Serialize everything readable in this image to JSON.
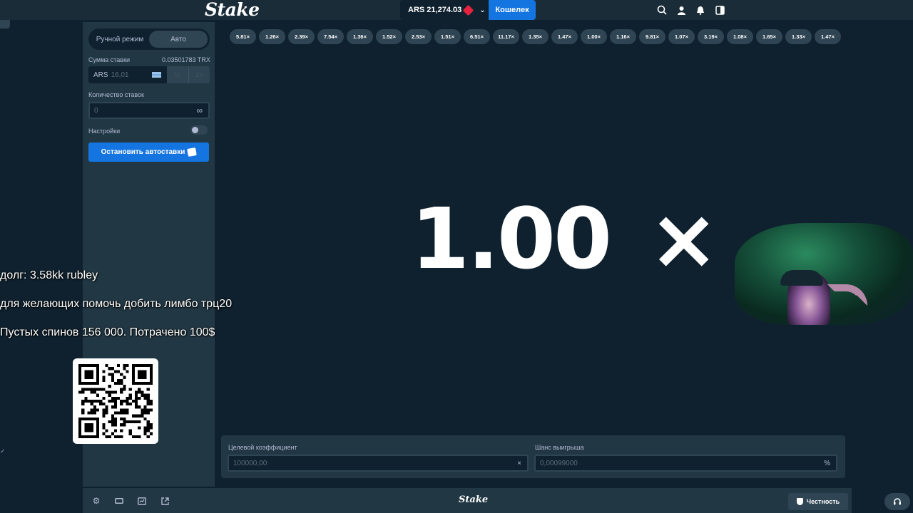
{
  "app": {
    "logo": "Stake",
    "footer_logo": "Stake"
  },
  "topbar": {
    "currency": "ARS",
    "balance": "21,274.03",
    "wallet_label": "Кошелек"
  },
  "sidebar": {
    "mode_manual": "Ручной режим",
    "mode_auto": "Авто",
    "bet_amount_label": "Сумма ставки",
    "bet_amount_crypto": "0.03501783 TRX",
    "bet_currency": "ARS",
    "bet_value": "16,01",
    "half_label": "½",
    "double_label": "2×",
    "bets_count_label": "Количество ставок",
    "bets_count_value": "0",
    "settings_label": "Настройки",
    "stop_button": "Остановить автоставки"
  },
  "history": [
    "5.81×",
    "1.26×",
    "2.39×",
    "7.54×",
    "1.36×",
    "1.52×",
    "2.53×",
    "1.51×",
    "6.51×",
    "11.17×",
    "1.35×",
    "1.47×",
    "1.00×",
    "1.16×",
    "9.81×",
    "1.07×",
    "3.19×",
    "1.08×",
    "1.65×",
    "1.33×",
    "1.47×"
  ],
  "result": {
    "multiplier": "1.00",
    "suffix": "×"
  },
  "bottom": {
    "target_label": "Целевой коэффициент",
    "target_value": "100000,00",
    "target_suffix": "×",
    "chance_label": "Шанс выигрыша",
    "chance_value": "0,00099000",
    "chance_suffix": "%"
  },
  "footer": {
    "fairness_label": "Честность"
  },
  "overlay": {
    "line1": "долг: 3.58kk rubley",
    "line2": "для желающих помочь добить лимбо трц20",
    "line3": "Пустых спинов 156 000. Потрачено 100$"
  },
  "colors": {
    "accent": "#1475e1",
    "panel": "#213743",
    "bg": "#0f212e",
    "chip": "#2f4553"
  }
}
